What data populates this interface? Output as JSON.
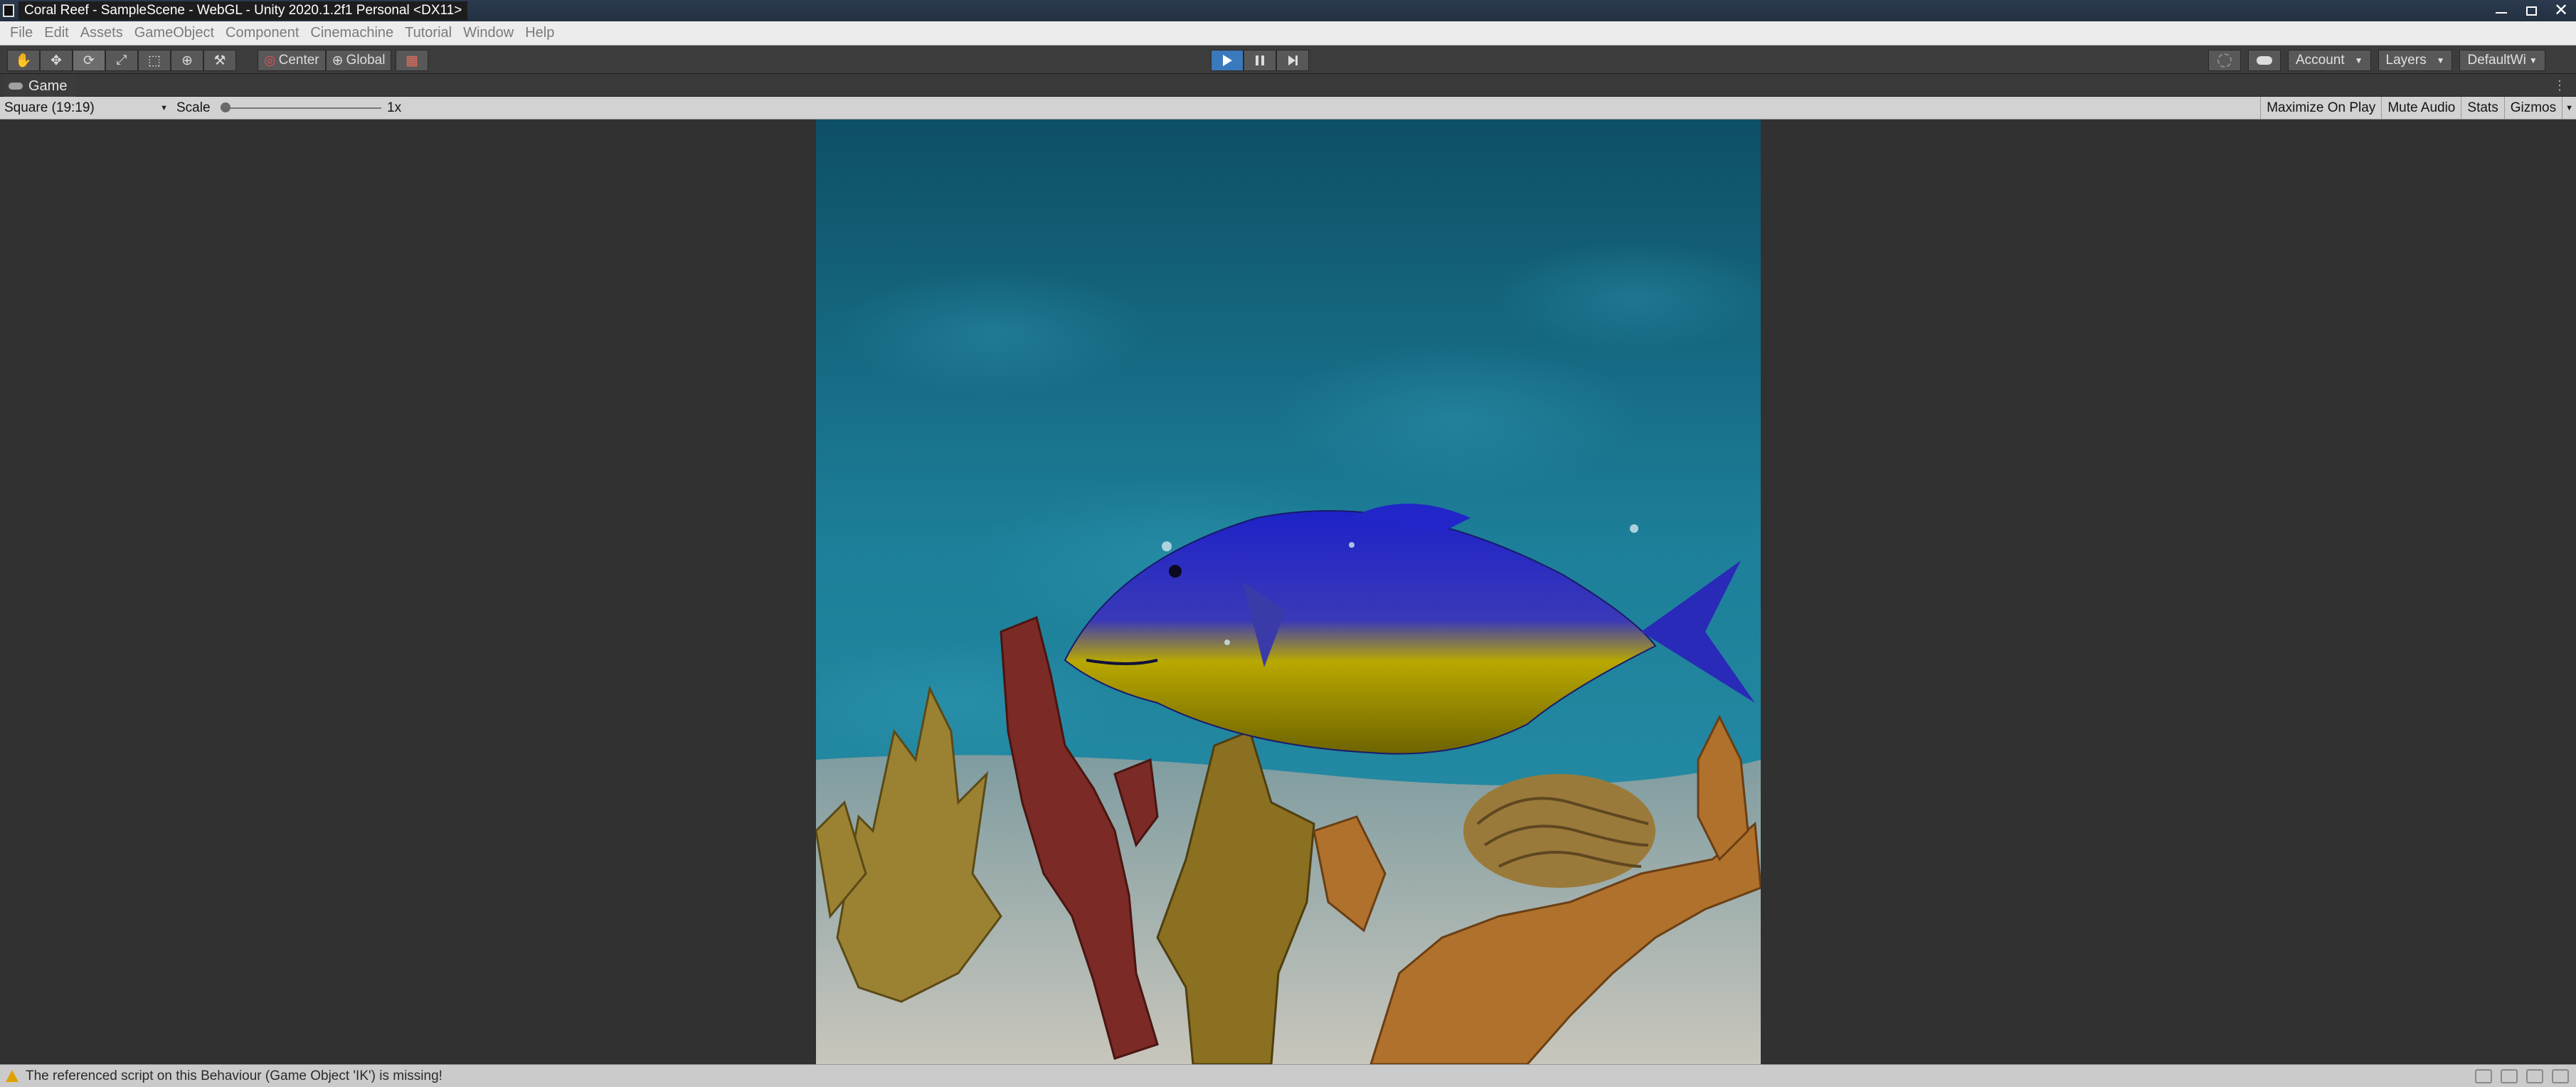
{
  "window": {
    "title": "Coral Reef - SampleScene - WebGL - Unity 2020.1.2f1 Personal <DX11>"
  },
  "menu": {
    "items": [
      "File",
      "Edit",
      "Assets",
      "GameObject",
      "Component",
      "Cinemachine",
      "Tutorial",
      "Window",
      "Help"
    ]
  },
  "toolbar": {
    "tools": [
      "hand-icon",
      "move-icon",
      "rotate-icon",
      "scale-icon",
      "rect-icon",
      "transform-icon",
      "custom-icon"
    ],
    "pivot_label": "Center",
    "space_label": "Global",
    "account_label": "Account",
    "layers_label": "Layers",
    "layout_label": "DefaultWi"
  },
  "game_tab": {
    "label": "Game"
  },
  "game_toolbar": {
    "aspect": "Square (19:19)",
    "scale_label": "Scale",
    "scale_value": "1x",
    "scale_fraction": 0.0,
    "maximize_on_play": "Maximize On Play",
    "mute_audio": "Mute Audio",
    "stats": "Stats",
    "gizmos": "Gizmos"
  },
  "status": {
    "message": "The referenced script on this Behaviour (Game Object 'IK') is missing!"
  },
  "colors": {
    "play_active": "#3a79bb",
    "water": "#1e7d96",
    "fish_top": "#2b2fd0",
    "fish_belly": "#c9b400",
    "warning": "#e0a200"
  }
}
